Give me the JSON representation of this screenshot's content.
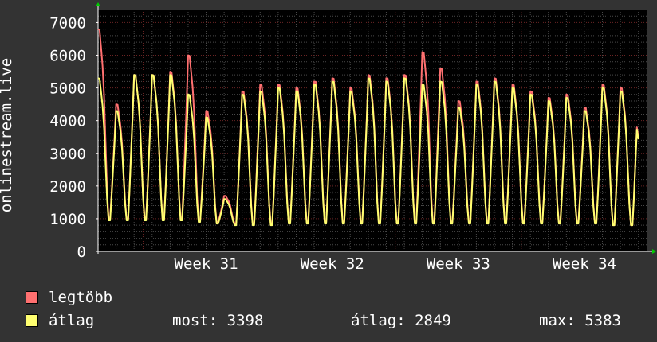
{
  "chart_data": {
    "type": "line",
    "ylabel": "onlinestream.live",
    "ylim": [
      0,
      7400
    ],
    "yticks": [
      0,
      1000,
      2000,
      3000,
      4000,
      5000,
      6000,
      7000
    ],
    "xticks": [
      "Week 31",
      "Week 32",
      "Week 33",
      "Week 34"
    ],
    "xlim_days": [
      0,
      30.5
    ],
    "xtick_days": [
      6,
      13,
      20,
      27
    ],
    "grid": true,
    "series": [
      {
        "name": "legtöbb",
        "color": "#ff7070",
        "daily_peaks": [
          6800,
          4500,
          5400,
          5400,
          5500,
          6000,
          4300,
          1700,
          4900,
          5100,
          5100,
          5000,
          5200,
          5300,
          5000,
          5400,
          5300,
          5400,
          6100,
          5600,
          4600,
          5200,
          5300,
          5100,
          4900,
          4700,
          4800,
          4400,
          5100,
          5000
        ],
        "daily_troughs": [
          1000,
          1000,
          1000,
          1000,
          1000,
          950,
          900,
          850,
          850,
          850,
          900,
          900,
          900,
          900,
          900,
          900,
          900,
          900,
          900,
          900,
          900,
          900,
          900,
          900,
          900,
          900,
          900,
          900,
          800,
          800
        ]
      },
      {
        "name": "átlag",
        "color": "#ffff70",
        "daily_peaks": [
          5300,
          4300,
          5400,
          5400,
          5400,
          4800,
          4100,
          1600,
          4800,
          4900,
          5000,
          4900,
          5100,
          5200,
          4900,
          5300,
          5200,
          5300,
          5100,
          5200,
          4400,
          5100,
          5200,
          5000,
          4800,
          4600,
          4700,
          4300,
          5000,
          4900
        ],
        "daily_troughs": [
          950,
          950,
          950,
          950,
          950,
          900,
          850,
          800,
          800,
          800,
          850,
          850,
          850,
          850,
          850,
          850,
          850,
          850,
          850,
          850,
          850,
          850,
          850,
          850,
          850,
          850,
          850,
          850,
          800,
          800
        ]
      }
    ]
  },
  "legend": {
    "max_label": "legtöbb",
    "avg_label": "átlag",
    "max_color": "#ff7070",
    "avg_color": "#ffff70"
  },
  "stats": {
    "now_label": "most:",
    "now_value": "3398",
    "avg_label": "átlag:",
    "avg_value": "2849",
    "max_label": "max:",
    "max_value": "5383"
  }
}
